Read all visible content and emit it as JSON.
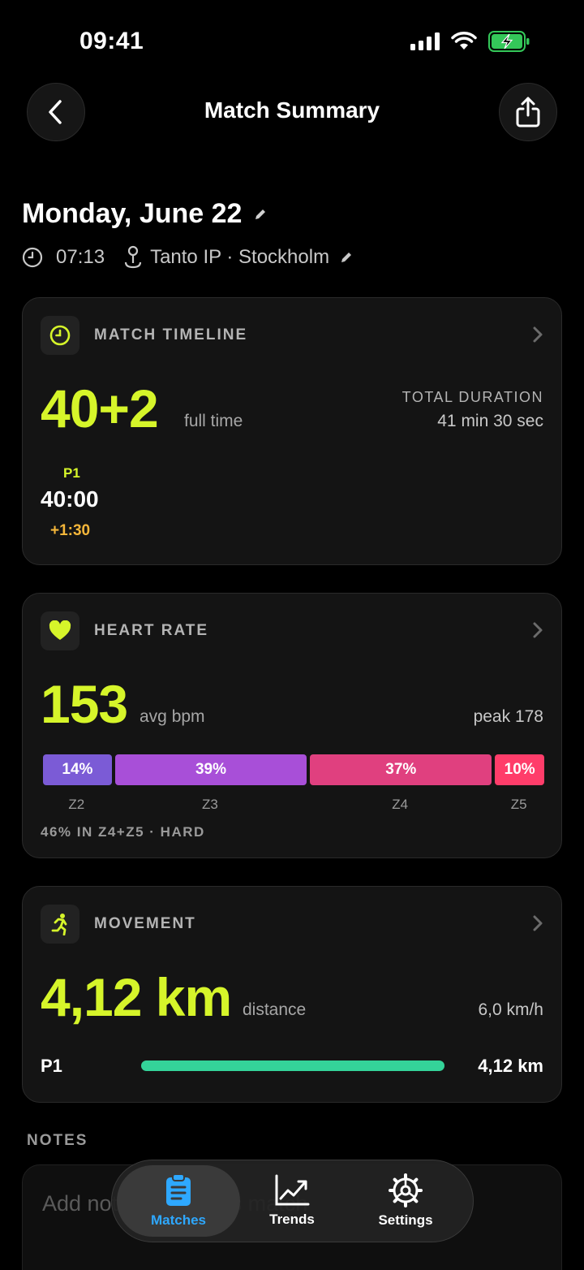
{
  "status": {
    "time": "09:41"
  },
  "header": {
    "title": "Match Summary"
  },
  "match": {
    "date": "Monday, June 22",
    "time": "07:13",
    "location": "Tanto IP · Stockholm"
  },
  "timeline": {
    "title": "MATCH TIMELINE",
    "score": "40+2",
    "score_label": "full time",
    "total_label": "TOTAL DURATION",
    "total_value": "41 min 30 sec",
    "period_label": "P1",
    "period_time": "40:00",
    "period_added": "+1:30"
  },
  "heart_rate": {
    "title": "HEART RATE",
    "avg": "153",
    "avg_label": "avg bpm",
    "peak": "peak 178",
    "zones": [
      {
        "label": "Z2",
        "percent": "14%",
        "value": 14,
        "color": "#7b5bd6"
      },
      {
        "label": "Z3",
        "percent": "39%",
        "value": 39,
        "color": "#a84fd8"
      },
      {
        "label": "Z4",
        "percent": "37%",
        "value": 37,
        "color": "#e0407f"
      },
      {
        "label": "Z5",
        "percent": "10%",
        "value": 10,
        "color": "#ff3d6a"
      }
    ],
    "summary": "46% IN Z4+Z5 · HARD"
  },
  "movement": {
    "title": "MOVEMENT",
    "distance": "4,12 km",
    "distance_label": "distance",
    "speed": "6,0 km/h",
    "period_label": "P1",
    "period_distance": "4,12 km",
    "bar_fill": 1.0,
    "bar_color": "#34d399"
  },
  "notes": {
    "heading": "NOTES",
    "placeholder": "Add notes about this match"
  },
  "tabs": [
    {
      "label": "Matches",
      "icon": "clipboard-icon",
      "active": true
    },
    {
      "label": "Trends",
      "icon": "trend-chart-icon",
      "active": false
    },
    {
      "label": "Settings",
      "icon": "gear-icon",
      "active": false
    }
  ],
  "colors": {
    "accent": "#d6f52a",
    "tab_active": "#2ea8ff",
    "added_time": "#f5b63a"
  }
}
